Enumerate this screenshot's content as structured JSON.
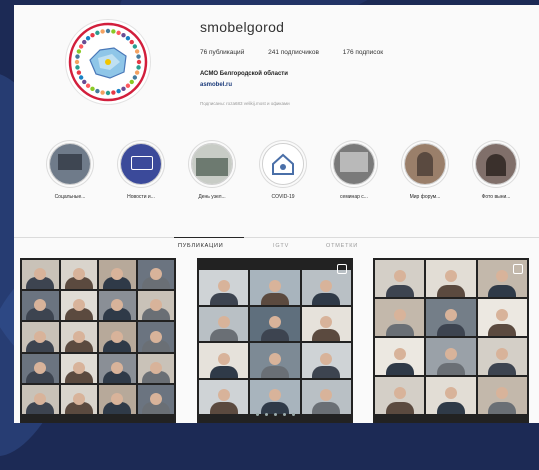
{
  "profile": {
    "username": "smobelgorod",
    "posts": "76 публикаций",
    "followers": "241 подписчиков",
    "following": "176 подписок",
    "bio_name": "АСМО Белгородской области",
    "bio_link": "asmobel.ru",
    "followed_by": "Подписаны: roza683 velikij.most и офиками"
  },
  "highlights": [
    {
      "label": "Соцальные...",
      "color": "#6f7b8a"
    },
    {
      "label": "Новости и...",
      "color": "#3b4a9a"
    },
    {
      "label": "День узел...",
      "color": "#8b9a8f"
    },
    {
      "label": "COVID-19",
      "color": "#ffffff"
    },
    {
      "label": "семинар с...",
      "color": "#7a7a7a"
    },
    {
      "label": "Мир форум...",
      "color": "#9a7f6a"
    },
    {
      "label": "Фото выни...",
      "color": "#806f6a"
    }
  ],
  "tabs": {
    "posts": "Публикации",
    "igtv": "IGTV",
    "tagged": "Отметки"
  },
  "colors": {
    "accent": "#262626",
    "background": "#fafafa"
  }
}
